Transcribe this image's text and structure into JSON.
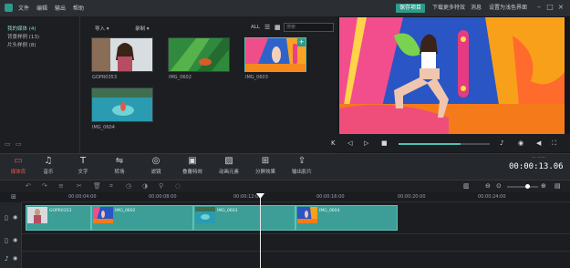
{
  "menubar": {
    "items": [
      "文件",
      "编辑",
      "输出",
      "帮助"
    ],
    "right_buttons": [
      "保存项目",
      "下载更多特效",
      "消息",
      "设置为浅色界面"
    ],
    "active_button_index": 0
  },
  "left_panel": {
    "items": [
      "我的媒体 (4)",
      "背景样例 (13)",
      "片头样例 (8)"
    ],
    "active_index": 0
  },
  "media": {
    "import_label": "导入",
    "record_label": "录制",
    "all_label": "ALL",
    "search_placeholder": "搜索",
    "thumbnails": [
      {
        "label": "GOPR0353"
      },
      {
        "label": "IMG_0602"
      },
      {
        "label": "IMG_0603"
      },
      {
        "label": "IMG_0604"
      }
    ]
  },
  "toolbar": {
    "tools": [
      {
        "label": "媒体库",
        "icon": "folder-icon"
      },
      {
        "label": "音乐",
        "icon": "music-icon"
      },
      {
        "label": "文字",
        "icon": "text-icon"
      },
      {
        "label": "转场",
        "icon": "transition-icon"
      },
      {
        "label": "滤镜",
        "icon": "filter-icon"
      },
      {
        "label": "叠覆特效",
        "icon": "overlay-icon"
      },
      {
        "label": "动画元素",
        "icon": "element-icon"
      },
      {
        "label": "分屏效果",
        "icon": "split-screen-icon"
      },
      {
        "label": "输出影片",
        "icon": "export-icon"
      }
    ],
    "active_index": 0
  },
  "timecode": "00:00:13.06",
  "timecode_top": "— ——",
  "ruler": {
    "labels": [
      "00:00:04:00",
      "00:00:08:00",
      "00:00:12:00",
      "00:00:16:00",
      "00:00:20:00",
      "00:00:24:00"
    ]
  },
  "timeline": {
    "clips": [
      {
        "name": "GOPR0353"
      },
      {
        "name": "IMG_0602"
      },
      {
        "name": "IMG_0603"
      },
      {
        "name": "IMG_0604"
      }
    ]
  },
  "colors": {
    "accent": "#2e9a8a",
    "active_red": "#e05a4a",
    "clip": "#3c9e97"
  }
}
